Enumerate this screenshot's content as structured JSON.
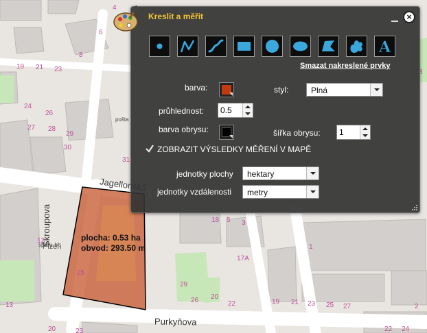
{
  "map": {
    "streets": {
      "jagellonska": "Jagellonská",
      "skroupova": "Škroupova",
      "purkynova": "Purkyňova"
    },
    "labels": {
      "posta": "pošta",
      "sprav": "správ. bl.",
      "plzen": "Plzeň"
    },
    "house_numbers": [
      "4",
      "6",
      "8",
      "19",
      "21",
      "23",
      "24",
      "26",
      "27",
      "28",
      "29",
      "30",
      "31",
      "12",
      "18",
      "5",
      "3",
      "1",
      "17A",
      "19",
      "21",
      "23",
      "25",
      "27",
      "29",
      "26",
      "20",
      "22",
      "23",
      "25",
      "13",
      "2",
      "8",
      "20",
      "24",
      "22"
    ],
    "measurement": {
      "area": "plocha: 0.53 ha",
      "perimeter": "obvod: 293.50 m"
    },
    "colors": {
      "measured_fill": "#c8603a",
      "measured_stroke": "#000000"
    }
  },
  "panel": {
    "title": "Kreslit a měřit",
    "tools": [
      {
        "name": "point-tool",
        "icon": "point-icon"
      },
      {
        "name": "polyline-tool",
        "icon": "polyline-icon"
      },
      {
        "name": "freehand-line-tool",
        "icon": "freehand-line-icon"
      },
      {
        "name": "rectangle-tool",
        "icon": "rectangle-icon"
      },
      {
        "name": "circle-tool",
        "icon": "circle-icon"
      },
      {
        "name": "ellipse-tool",
        "icon": "ellipse-icon"
      },
      {
        "name": "polygon-tool",
        "icon": "polygon-icon"
      },
      {
        "name": "freehand-polygon-tool",
        "icon": "freehand-polygon-icon"
      },
      {
        "name": "text-tool",
        "icon": "text-icon"
      }
    ],
    "clear_link": "Smazat nakreslené prvky",
    "color_label": "barva:",
    "style_label": "styl:",
    "style_value": "Plná",
    "transparency_label": "průhlednost:",
    "transparency_value": "0.5",
    "outline_color_label": "barva obrysu:",
    "outline_width_label": "šířka obrysu:",
    "outline_width_value": "1",
    "show_measure_label": "ZOBRAZIT VÝSLEDKY MĚŘENÍ V MAPĚ",
    "show_measure_checked": true,
    "area_units_label": "jednotky plochy",
    "area_units_value": "hektary",
    "distance_units_label": "jednotky vzdálenosti",
    "distance_units_value": "metry",
    "colors": {
      "fill_color": "#c23a12",
      "outline_color": "#000000",
      "title_color": "#f3c534",
      "tool_icon_color": "#3aa8dc"
    }
  }
}
